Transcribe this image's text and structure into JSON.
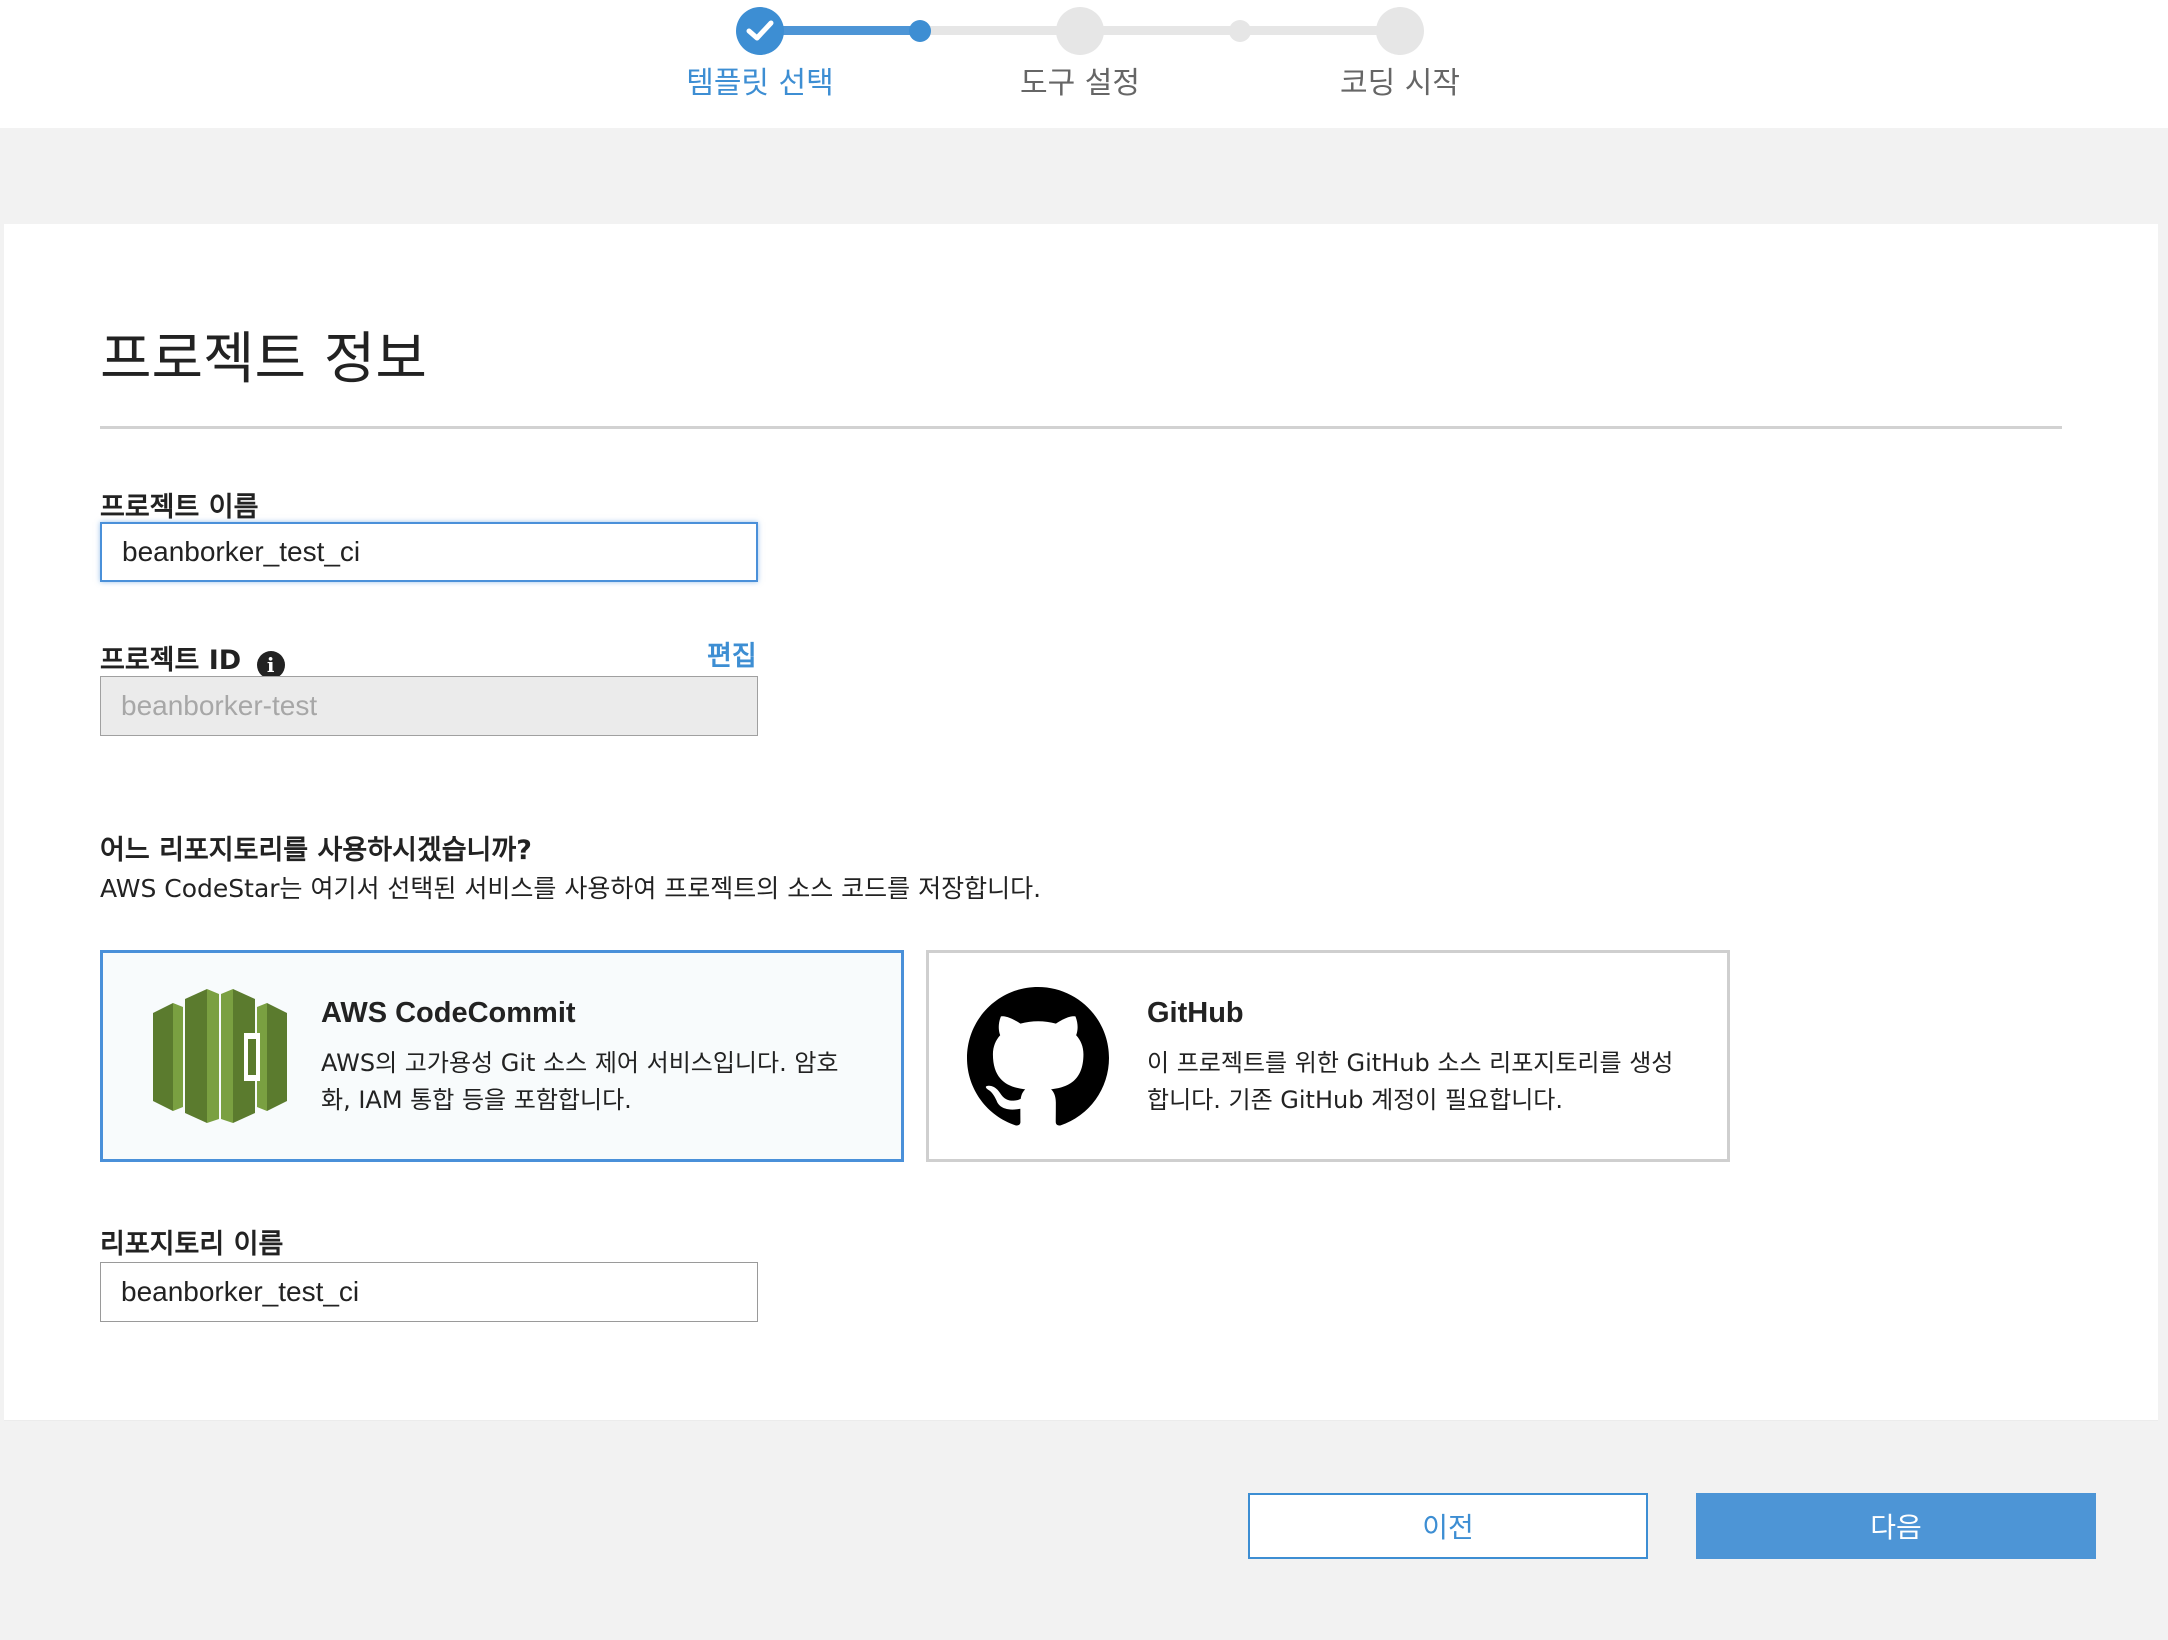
{
  "stepper": {
    "steps": [
      {
        "label": "템플릿 선택",
        "state": "done"
      },
      {
        "label": "도구 설정",
        "state": "pending"
      },
      {
        "label": "코딩 시작",
        "state": "pending"
      }
    ]
  },
  "card": {
    "title": "프로젝트 정보",
    "project_name": {
      "label": "프로젝트 이름",
      "value": "beanborker_test_ci"
    },
    "project_id": {
      "label": "프로젝트 ID",
      "value": "beanborker-test",
      "edit_label": "편집",
      "info_icon": "i"
    },
    "repository_question": {
      "title": "어느 리포지토리를 사용하시겠습니까?",
      "description": "AWS CodeStar는 여기서 선택된 서비스를 사용하여 프로젝트의 소스 코드를 저장합니다."
    },
    "repo_options": [
      {
        "name": "AWS CodeCommit",
        "description": "AWS의 고가용성 Git 소스 제어 서비스입니다. 암호화, IAM 통합 등을 포함합니다.",
        "icon": "codecommit-icon",
        "selected": true
      },
      {
        "name": "GitHub",
        "description": "이 프로젝트를 위한 GitHub 소스 리포지토리를 생성합니다. 기존 GitHub 계정이 필요합니다.",
        "icon": "github-icon",
        "selected": false
      }
    ],
    "repository_name": {
      "label": "리포지토리 이름",
      "value": "beanborker_test_ci"
    }
  },
  "footer": {
    "prev_label": "이전",
    "next_label": "다음"
  },
  "colors": {
    "accent": "#3d8ed3",
    "primary_button": "#4d95d6",
    "codecommit_green": "#6b8e3a"
  }
}
